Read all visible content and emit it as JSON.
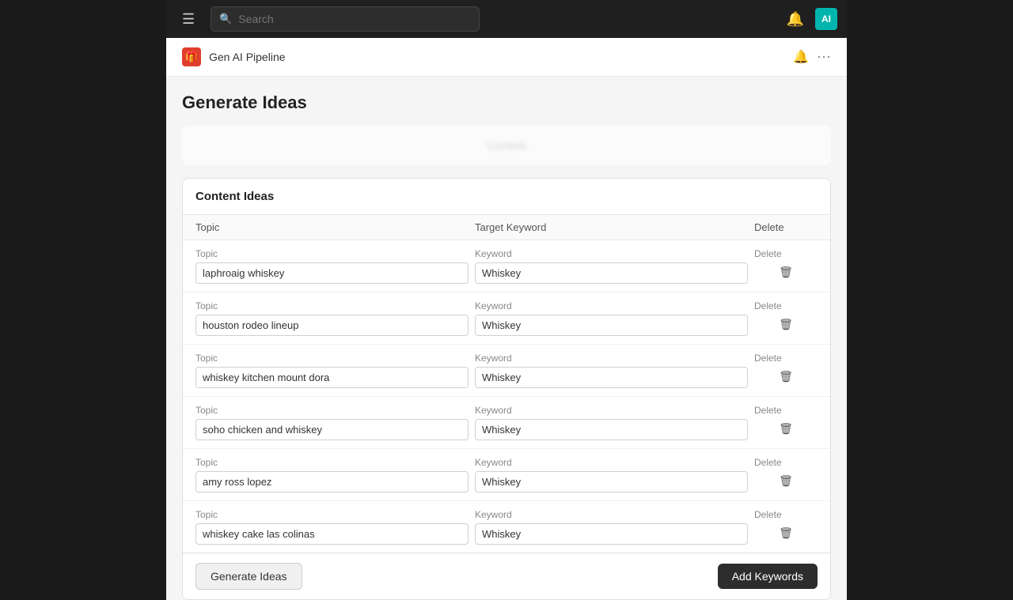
{
  "nav": {
    "search_placeholder": "Search",
    "hamburger_label": "☰",
    "bell_icon": "🔔",
    "avatar_text": "AI",
    "avatar_bg": "#00b5ad"
  },
  "page_header": {
    "app_name": "Gen AI Pipeline",
    "app_icon": "🎁",
    "bell_icon": "🔔",
    "more_icon": "⋯"
  },
  "page": {
    "title": "Generate Ideas"
  },
  "content_ideas": {
    "section_title": "Content Ideas",
    "columns": {
      "topic": "Topic",
      "keyword": "Target Keyword",
      "delete": "Delete"
    },
    "rows": [
      {
        "topic_label": "Topic",
        "topic_value": "laphroaig whiskey",
        "keyword_label": "Keyword",
        "keyword_value": "Whiskey",
        "delete_label": "Delete"
      },
      {
        "topic_label": "Topic",
        "topic_value": "houston rodeo lineup",
        "keyword_label": "Keyword",
        "keyword_value": "Whiskey",
        "delete_label": "Delete"
      },
      {
        "topic_label": "Topic",
        "topic_value": "whiskey kitchen mount dora",
        "keyword_label": "Keyword",
        "keyword_value": "Whiskey",
        "delete_label": "Delete"
      },
      {
        "topic_label": "Topic",
        "topic_value": "soho chicken and whiskey",
        "keyword_label": "Keyword",
        "keyword_value": "Whiskey",
        "delete_label": "Delete"
      },
      {
        "topic_label": "Topic",
        "topic_value": "amy ross lopez",
        "keyword_label": "Keyword",
        "keyword_value": "Whiskey",
        "delete_label": "Delete"
      },
      {
        "topic_label": "Topic",
        "topic_value": "whiskey cake las colinas",
        "keyword_label": "Keyword",
        "keyword_value": "Whiskey",
        "delete_label": "Delete"
      }
    ],
    "generate_btn": "Generate Ideas",
    "add_keywords_btn": "Add Keywords"
  }
}
